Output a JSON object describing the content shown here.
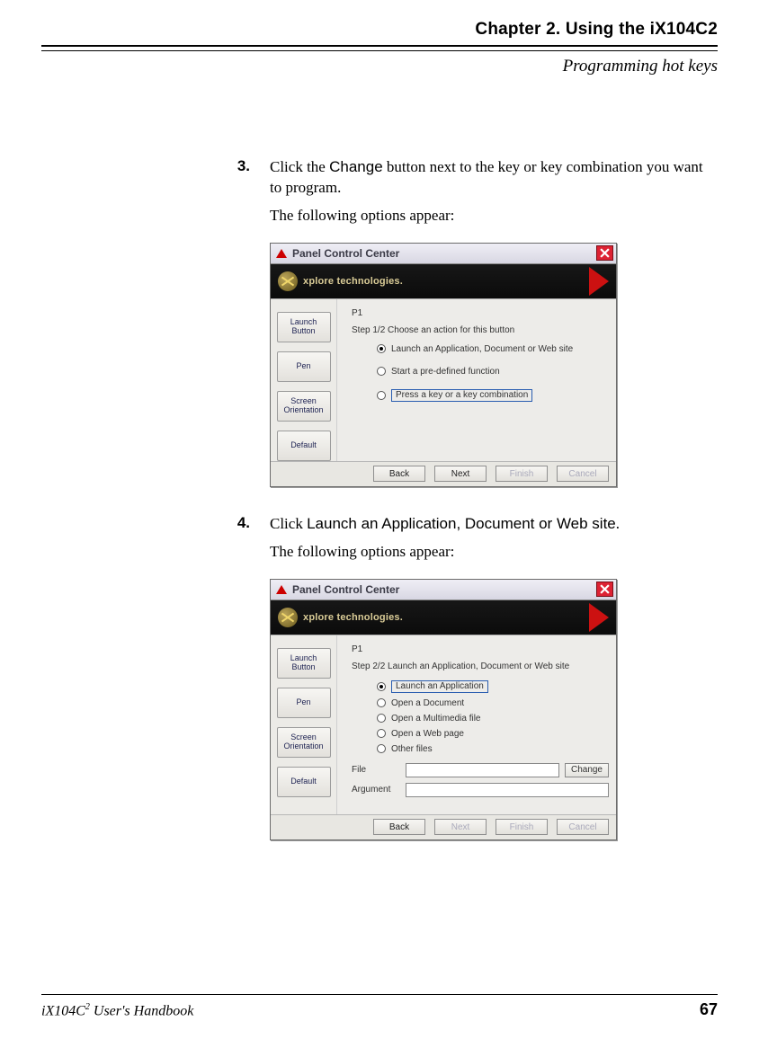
{
  "header": {
    "chapter": "Chapter 2. Using the iX104C2",
    "section": "Programming hot keys"
  },
  "steps": [
    {
      "num": "3.",
      "pre": "Click the ",
      "ui": "Change",
      "post": " button next to the key or key combination you want to program.",
      "followup": "The following options appear:"
    },
    {
      "num": "4.",
      "pre": "Click ",
      "ui": "Launch an Application, Document or Web site",
      "post": ".",
      "followup": "The following options appear:"
    }
  ],
  "shot1": {
    "title": "Panel Control Center",
    "brand": "xplore technologies.",
    "sidebar": [
      "Launch Button",
      "Pen",
      "Screen Orientation",
      "Default"
    ],
    "heading": "P1",
    "stepLabel": "Step 1/2    Choose an action for this button",
    "options": [
      "Launch an Application, Document or Web site",
      "Start a pre-defined function",
      "Press a key or a key combination"
    ],
    "buttons": [
      "Back",
      "Next",
      "Finish",
      "Cancel"
    ]
  },
  "shot2": {
    "title": "Panel Control Center",
    "brand": "xplore technologies.",
    "sidebar": [
      "Launch Button",
      "Pen",
      "Screen Orientation",
      "Default"
    ],
    "heading": "P1",
    "stepLabel": "Step 2/2    Launch an Application, Document or Web site",
    "options": [
      "Launch an Application",
      "Open a Document",
      "Open a Multimedia file",
      "Open a Web page",
      "Other files"
    ],
    "fileLabel": "File",
    "argLabel": "Argument",
    "changeBtn": "Change",
    "buttons": [
      "Back",
      "Next",
      "Finish",
      "Cancel"
    ]
  },
  "footer": {
    "left_pre": "iX104C",
    "left_sup": "2",
    "left_post": " User's Handbook",
    "page": "67"
  }
}
